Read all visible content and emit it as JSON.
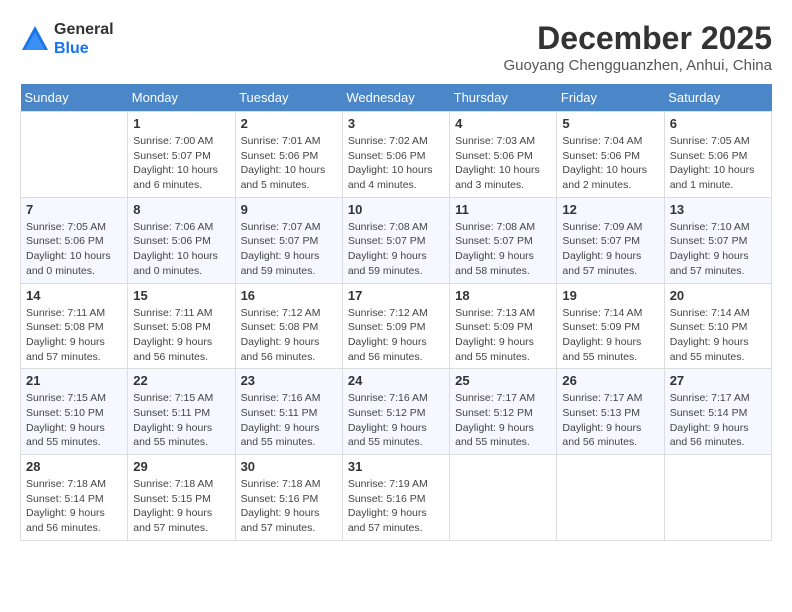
{
  "header": {
    "logo_general": "General",
    "logo_blue": "Blue",
    "month": "December 2025",
    "location": "Guoyang Chengguanzhen, Anhui, China"
  },
  "weekdays": [
    "Sunday",
    "Monday",
    "Tuesday",
    "Wednesday",
    "Thursday",
    "Friday",
    "Saturday"
  ],
  "weeks": [
    [
      {
        "day": "",
        "info": ""
      },
      {
        "day": "1",
        "info": "Sunrise: 7:00 AM\nSunset: 5:07 PM\nDaylight: 10 hours\nand 6 minutes."
      },
      {
        "day": "2",
        "info": "Sunrise: 7:01 AM\nSunset: 5:06 PM\nDaylight: 10 hours\nand 5 minutes."
      },
      {
        "day": "3",
        "info": "Sunrise: 7:02 AM\nSunset: 5:06 PM\nDaylight: 10 hours\nand 4 minutes."
      },
      {
        "day": "4",
        "info": "Sunrise: 7:03 AM\nSunset: 5:06 PM\nDaylight: 10 hours\nand 3 minutes."
      },
      {
        "day": "5",
        "info": "Sunrise: 7:04 AM\nSunset: 5:06 PM\nDaylight: 10 hours\nand 2 minutes."
      },
      {
        "day": "6",
        "info": "Sunrise: 7:05 AM\nSunset: 5:06 PM\nDaylight: 10 hours\nand 1 minute."
      }
    ],
    [
      {
        "day": "7",
        "info": "Sunrise: 7:05 AM\nSunset: 5:06 PM\nDaylight: 10 hours\nand 0 minutes."
      },
      {
        "day": "8",
        "info": "Sunrise: 7:06 AM\nSunset: 5:06 PM\nDaylight: 10 hours\nand 0 minutes."
      },
      {
        "day": "9",
        "info": "Sunrise: 7:07 AM\nSunset: 5:07 PM\nDaylight: 9 hours\nand 59 minutes."
      },
      {
        "day": "10",
        "info": "Sunrise: 7:08 AM\nSunset: 5:07 PM\nDaylight: 9 hours\nand 59 minutes."
      },
      {
        "day": "11",
        "info": "Sunrise: 7:08 AM\nSunset: 5:07 PM\nDaylight: 9 hours\nand 58 minutes."
      },
      {
        "day": "12",
        "info": "Sunrise: 7:09 AM\nSunset: 5:07 PM\nDaylight: 9 hours\nand 57 minutes."
      },
      {
        "day": "13",
        "info": "Sunrise: 7:10 AM\nSunset: 5:07 PM\nDaylight: 9 hours\nand 57 minutes."
      }
    ],
    [
      {
        "day": "14",
        "info": "Sunrise: 7:11 AM\nSunset: 5:08 PM\nDaylight: 9 hours\nand 57 minutes."
      },
      {
        "day": "15",
        "info": "Sunrise: 7:11 AM\nSunset: 5:08 PM\nDaylight: 9 hours\nand 56 minutes."
      },
      {
        "day": "16",
        "info": "Sunrise: 7:12 AM\nSunset: 5:08 PM\nDaylight: 9 hours\nand 56 minutes."
      },
      {
        "day": "17",
        "info": "Sunrise: 7:12 AM\nSunset: 5:09 PM\nDaylight: 9 hours\nand 56 minutes."
      },
      {
        "day": "18",
        "info": "Sunrise: 7:13 AM\nSunset: 5:09 PM\nDaylight: 9 hours\nand 55 minutes."
      },
      {
        "day": "19",
        "info": "Sunrise: 7:14 AM\nSunset: 5:09 PM\nDaylight: 9 hours\nand 55 minutes."
      },
      {
        "day": "20",
        "info": "Sunrise: 7:14 AM\nSunset: 5:10 PM\nDaylight: 9 hours\nand 55 minutes."
      }
    ],
    [
      {
        "day": "21",
        "info": "Sunrise: 7:15 AM\nSunset: 5:10 PM\nDaylight: 9 hours\nand 55 minutes."
      },
      {
        "day": "22",
        "info": "Sunrise: 7:15 AM\nSunset: 5:11 PM\nDaylight: 9 hours\nand 55 minutes."
      },
      {
        "day": "23",
        "info": "Sunrise: 7:16 AM\nSunset: 5:11 PM\nDaylight: 9 hours\nand 55 minutes."
      },
      {
        "day": "24",
        "info": "Sunrise: 7:16 AM\nSunset: 5:12 PM\nDaylight: 9 hours\nand 55 minutes."
      },
      {
        "day": "25",
        "info": "Sunrise: 7:17 AM\nSunset: 5:12 PM\nDaylight: 9 hours\nand 55 minutes."
      },
      {
        "day": "26",
        "info": "Sunrise: 7:17 AM\nSunset: 5:13 PM\nDaylight: 9 hours\nand 56 minutes."
      },
      {
        "day": "27",
        "info": "Sunrise: 7:17 AM\nSunset: 5:14 PM\nDaylight: 9 hours\nand 56 minutes."
      }
    ],
    [
      {
        "day": "28",
        "info": "Sunrise: 7:18 AM\nSunset: 5:14 PM\nDaylight: 9 hours\nand 56 minutes."
      },
      {
        "day": "29",
        "info": "Sunrise: 7:18 AM\nSunset: 5:15 PM\nDaylight: 9 hours\nand 57 minutes."
      },
      {
        "day": "30",
        "info": "Sunrise: 7:18 AM\nSunset: 5:16 PM\nDaylight: 9 hours\nand 57 minutes."
      },
      {
        "day": "31",
        "info": "Sunrise: 7:19 AM\nSunset: 5:16 PM\nDaylight: 9 hours\nand 57 minutes."
      },
      {
        "day": "",
        "info": ""
      },
      {
        "day": "",
        "info": ""
      },
      {
        "day": "",
        "info": ""
      }
    ]
  ]
}
